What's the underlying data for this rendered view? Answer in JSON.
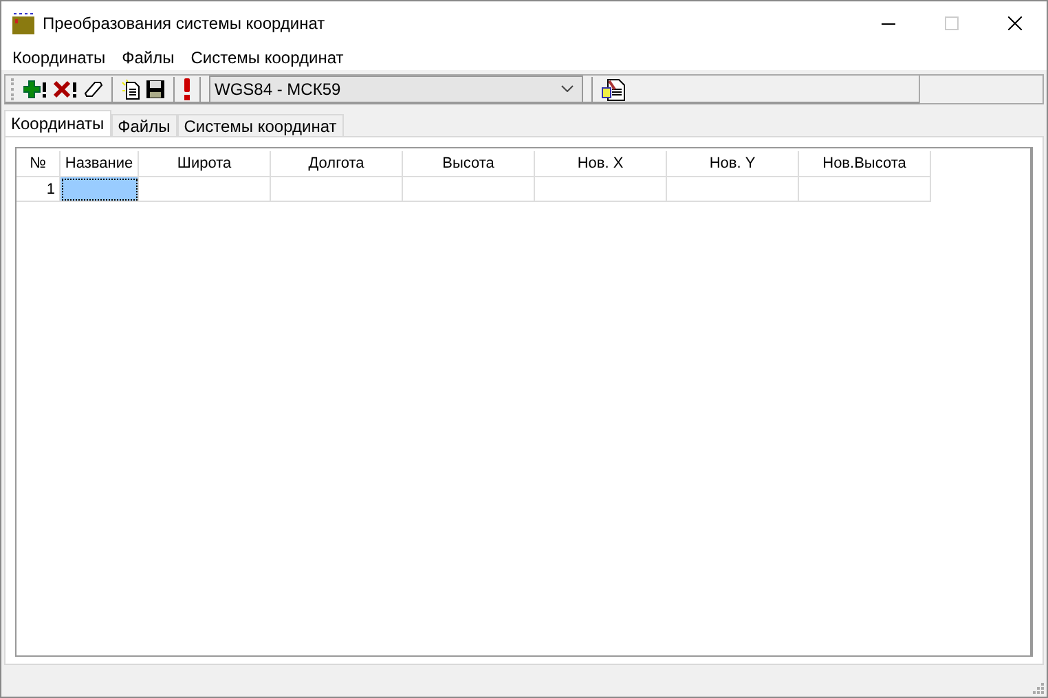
{
  "window": {
    "title": "Преобразования системы координат"
  },
  "menu": [
    "Координаты",
    "Файлы",
    "Системы координат"
  ],
  "toolbar": {
    "system": "WGS84 - МСК59"
  },
  "tabs": [
    {
      "label": "Координаты",
      "selected": true
    },
    {
      "label": "Файлы",
      "selected": false
    },
    {
      "label": "Системы координат",
      "selected": false
    }
  ],
  "table": {
    "columns": [
      "№",
      "Название",
      "Широта",
      "Долгота",
      "Высота",
      "Нов. X",
      "Нов. Y",
      "Нов.Высота"
    ],
    "rows": [
      {
        "number": "1",
        "cells": [
          {
            "selected": true
          },
          {
            "selected": false
          },
          {
            "selected": false
          },
          {
            "selected": false
          },
          {
            "selected": false
          },
          {
            "selected": false
          },
          {
            "selected": false
          }
        ]
      }
    ]
  }
}
